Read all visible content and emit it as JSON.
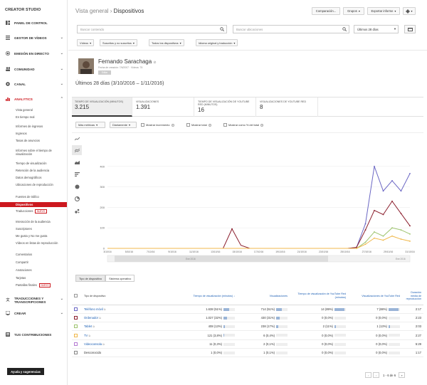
{
  "sidebar": {
    "title": "CREATOR STUDIO",
    "sections": [
      {
        "label": "PANEL DE CONTROL",
        "icon": "dashboard-icon"
      },
      {
        "label": "GESTOR DE VÍDEOS",
        "icon": "video-manager-icon"
      },
      {
        "label": "EMISIÓN EN DIRECTO",
        "icon": "live-icon"
      },
      {
        "label": "COMUNIDAD",
        "icon": "community-icon"
      },
      {
        "label": "CANAL",
        "icon": "channel-icon"
      },
      {
        "label": "ANALYTICS",
        "icon": "analytics-icon"
      }
    ],
    "analytics_items": [
      "Vista general",
      "En tiempo real",
      "Informes de ingresos",
      "Ingresos",
      "Tasas de anuncios",
      "Informes sobre el tiempo de visualización",
      "Tiempo de visualización",
      "Retención de la audiencia",
      "Datos demográficos",
      "Ubicaciones de reproducción",
      "Fuentes de tráfico",
      "Dispositivos",
      "Traducciones",
      "Interacción de la audiencia",
      "Suscriptores",
      "Me gusta y No me gusta",
      "Vídeos en listas de reproducción",
      "Comentarios",
      "Compartir",
      "Anotaciones",
      "Tarjetas",
      "Pantallas finales"
    ],
    "new_badge": "NUEVO",
    "bottom_sections": [
      {
        "label": "TRADUCCIONES Y TRANSCRIPCIONES",
        "icon": "translate-icon"
      },
      {
        "label": "CREAR",
        "icon": "create-icon"
      },
      {
        "label": "TUS CONTRIBUCIONES",
        "icon": "contributions-icon"
      }
    ],
    "help_button": "Ayuda y sugerencias"
  },
  "header": {
    "breadcrumb_parent": "Vista general",
    "breadcrumb_sep": " › ",
    "breadcrumb_current": "Dispositivos",
    "compare_btn": "Comparación...",
    "groups_btn": "Grupos",
    "export_btn": "Exportar informe"
  },
  "search": {
    "content_placeholder": "Buscar contenido",
    "location_placeholder": "Buscar ubicaciones",
    "period": "Últimos 28 días"
  },
  "filters": [
    "Vídeos",
    "Suscritos y no suscritos",
    "Todos los dispositivos",
    "Idioma original y traducción"
  ],
  "channel": {
    "name": "Fernando Sarachaga",
    "meta": "Fecha de creación: 7/6/2007 · Vídeos: 75",
    "badge": "Editar",
    "range": "Últimos 28 días (3/10/2016 – 1/11/2016)"
  },
  "metrics": [
    {
      "label": "TIEMPO DE VISUALIZACIÓN (MINUTOS)",
      "value": "3.215"
    },
    {
      "label": "VISUALIZACIONES",
      "value": "1.391"
    },
    {
      "label": "TIEMPO DE VISUALIZACIÓN DE YOUTUBE RED (MINUTOS)",
      "value": "16"
    },
    {
      "label": "VISUALIZACIONES DE YOUTUBE RED",
      "value": "8"
    }
  ],
  "controls": {
    "more_metrics": "Más métricas",
    "group_by": "Diariamente",
    "show_increment": "Mostrar incremento",
    "show_total": "Mostrar total",
    "show_pct": "Mostrar como % del total"
  },
  "chart_data": {
    "type": "line",
    "x": [
      "3/10/16",
      "5/10/16",
      "7/10/16",
      "9/10/16",
      "11/10/16",
      "13/10/16",
      "15/10/16",
      "17/10/16",
      "19/10/16",
      "21/10/16",
      "23/10/16",
      "25/10/16",
      "27/10/16",
      "29/10/16",
      "31/10/16"
    ],
    "ylim": [
      0,
      500
    ],
    "yticks": [
      0,
      100,
      200,
      300,
      400
    ],
    "series": [
      {
        "name": "Teléfono móvil",
        "color": "#6b67c4",
        "values": [
          0,
          0,
          0,
          0,
          0,
          0,
          0,
          0,
          0,
          0,
          0,
          0,
          0,
          0,
          0,
          0,
          0,
          0,
          0,
          0,
          0,
          0,
          0,
          0,
          0,
          0,
          0,
          0,
          5,
          120,
          400,
          280,
          330,
          280,
          365
        ]
      },
      {
        "name": "Ordenador",
        "color": "#8b1f2e",
        "values": [
          0,
          0,
          0,
          0,
          0,
          0,
          0,
          0,
          0,
          0,
          0,
          0,
          0,
          0,
          95,
          15,
          0,
          0,
          0,
          0,
          0,
          0,
          0,
          0,
          0,
          0,
          0,
          0,
          5,
          90,
          185,
          165,
          230,
          170,
          110
        ]
      },
      {
        "name": "Tablet",
        "color": "#9ec46f",
        "values": [
          0,
          0,
          0,
          0,
          0,
          0,
          0,
          0,
          0,
          0,
          0,
          0,
          0,
          0,
          0,
          0,
          0,
          0,
          0,
          0,
          0,
          0,
          0,
          0,
          0,
          0,
          0,
          0,
          0,
          30,
          80,
          60,
          100,
          90,
          70
        ]
      },
      {
        "name": "TV",
        "color": "#f0b84c",
        "values": [
          0,
          0,
          0,
          0,
          0,
          0,
          0,
          0,
          0,
          0,
          0,
          0,
          0,
          0,
          0,
          0,
          0,
          0,
          0,
          0,
          0,
          0,
          0,
          0,
          0,
          0,
          0,
          0,
          0,
          20,
          50,
          40,
          60,
          45,
          35
        ]
      }
    ],
    "range_labels": [
      "Ene 2016",
      "Ene 2016"
    ]
  },
  "table": {
    "tabs": [
      "Tipo de dispositivo",
      "Sistema operativo"
    ],
    "headers": [
      "Tipo de dispositivo",
      "Tiempo de visualización (minutos)",
      "Visualizaciones",
      "Tiempo de visualización de YouTube Red (minutos)",
      "Visualizaciones de YouTube Red",
      "Duración media de reproducción"
    ],
    "rows": [
      {
        "name": "Teléfono móvil",
        "color": "#6b67c4",
        "link": true,
        "wt": "1.638 (51%)",
        "wtp": 51,
        "v": "714 (51%)",
        "vp": 51,
        "rwt": "14 (89%)",
        "rwtp": 89,
        "rv": "7 (88%)",
        "rvp": 88,
        "avg": "2:17"
      },
      {
        "name": "Ordenador",
        "color": "#8b1f2e",
        "link": true,
        "wt": "1.027 (32%)",
        "wtp": 32,
        "v": "430 (31%)",
        "vp": 31,
        "rwt": "0 (0,0%)",
        "rwtp": 0,
        "rv": "0 (0,0%)",
        "rvp": 0,
        "avg": "2:23"
      },
      {
        "name": "Tablet",
        "color": "#9ec46f",
        "link": true,
        "wt": "408 (13%)",
        "wtp": 13,
        "v": "238 (17%)",
        "vp": 17,
        "rwt": "2 (11%)",
        "rwtp": 11,
        "rv": "1 (13%)",
        "rvp": 13,
        "avg": "2:03"
      },
      {
        "name": "TV",
        "color": "#f0b84c",
        "link": true,
        "wt": "121 (3,8%)",
        "wtp": 4,
        "v": "6 (0,4%)",
        "vp": 0,
        "rwt": "0 (0,0%)",
        "rwtp": 0,
        "rv": "0 (0,0%)",
        "rvp": 0,
        "avg": "2:27"
      },
      {
        "name": "Videoconsola",
        "color": "#b57ad2",
        "link": true,
        "wt": "11 (0,3%)",
        "wtp": 0,
        "v": "2 (0,1%)",
        "vp": 0,
        "rwt": "0 (0,0%)",
        "rwtp": 0,
        "rv": "0 (0,0%)",
        "rvp": 0,
        "avg": "5:29"
      },
      {
        "name": "Desconocido",
        "color": "#888888",
        "link": false,
        "wt": "1 (0,0%)",
        "wtp": 0,
        "v": "1 (0,1%)",
        "vp": 0,
        "rwt": "0 (0,0%)",
        "rwtp": 0,
        "rv": "0 (0,0%)",
        "rvp": 0,
        "avg": "1:17"
      }
    ],
    "pager": "1 - 6 de 6"
  }
}
